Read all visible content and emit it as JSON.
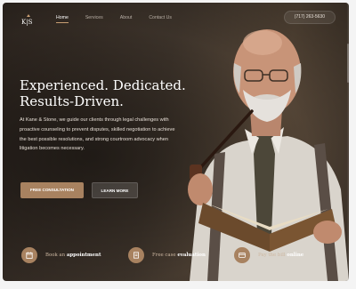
{
  "header": {
    "logo_text": "K|S",
    "nav": [
      {
        "label": "Home",
        "active": true
      },
      {
        "label": "Services",
        "active": false
      },
      {
        "label": "About",
        "active": false
      },
      {
        "label": "Contact Us",
        "active": false
      }
    ],
    "phone": "(717) 263-5630"
  },
  "hero": {
    "title_line1": "Experienced. Dedicated.",
    "title_line2": "Results-Driven.",
    "description": "At Kane & Stone, we guide our clients through legal challenges with proactive counseling to prevent disputes, skilled negotiation to achieve the best possible resolutions, and strong courtroom advocacy when litigation becomes necessary.",
    "primary_button": "FREE CONSULTATION",
    "secondary_button": "LEARN MORE"
  },
  "features": [
    {
      "prefix": "Book an",
      "bold": "appointment",
      "icon": "calendar-icon"
    },
    {
      "prefix": "Free case",
      "bold": "evaluation",
      "icon": "document-icon"
    },
    {
      "prefix": "Pay the bill",
      "bold": "online",
      "icon": "card-icon"
    }
  ],
  "colors": {
    "accent": "#a88260",
    "background_dark": "#2e2620",
    "text_light": "#ffffff"
  }
}
